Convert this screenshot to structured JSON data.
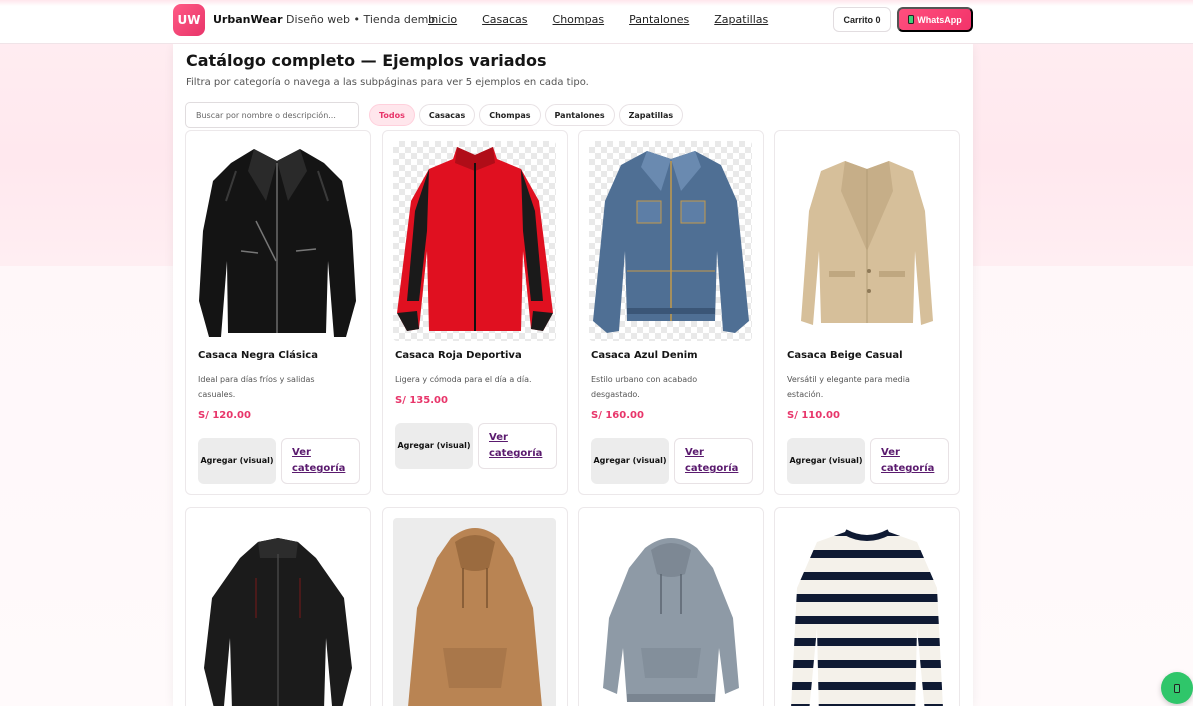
{
  "header": {
    "logo_text": "UW",
    "brand_name": "UrbanWear",
    "brand_tagline": " Diseño web • Tienda demo",
    "nav": [
      {
        "label": "Inicio"
      },
      {
        "label": "Casacas"
      },
      {
        "label": "Chompas"
      },
      {
        "label": "Pantalones"
      },
      {
        "label": "Zapatillas"
      }
    ],
    "cart_label": "Carrito 0",
    "whatsapp_label": "WhatsApp"
  },
  "main": {
    "title": "Catálogo completo — Ejemplos variados",
    "subtitle": "Filtra por categoría o navega a las subpáginas para ver 5 ejemplos en cada tipo.",
    "search": {
      "placeholder": "Buscar por nombre o descripción...",
      "value": ""
    },
    "filters": [
      {
        "label": "Todos",
        "active": true
      },
      {
        "label": "Casacas",
        "active": false
      },
      {
        "label": "Chompas",
        "active": false
      },
      {
        "label": "Pantalones",
        "active": false
      },
      {
        "label": "Zapatillas",
        "active": false
      }
    ]
  },
  "products": [
    {
      "title": "Casaca Negra Clásica",
      "desc": "Ideal para días fríos y salidas casuales.",
      "price": "S/ 120.00",
      "add_label": "Agregar (visual)",
      "cat_label": "Ver categoría",
      "image": "black-leather-jacket"
    },
    {
      "title": "Casaca Roja Deportiva",
      "desc": "Ligera y cómoda para el día a día.",
      "price": "S/ 135.00",
      "add_label": "Agregar (visual)",
      "cat_label": "Ver categoría",
      "image": "red-sport-jacket"
    },
    {
      "title": "Casaca Azul Denim",
      "desc": "Estilo urbano con acabado desgastado.",
      "price": "S/ 160.00",
      "add_label": "Agregar (visual)",
      "cat_label": "Ver categoría",
      "image": "denim-jacket"
    },
    {
      "title": "Casaca Beige Casual",
      "desc": "Versátil y elegante para media estación.",
      "price": "S/ 110.00",
      "add_label": "Agregar (visual)",
      "cat_label": "Ver categoría",
      "image": "beige-blazer"
    },
    {
      "image": "black-fleece-jacket"
    },
    {
      "image": "tan-hoodie"
    },
    {
      "image": "grey-hoodie"
    },
    {
      "image": "striped-sweater"
    }
  ],
  "colors": {
    "accent": "#e8356a",
    "whatsapp_green": "#2fc66a",
    "link_purple": "#5a1a6e"
  }
}
